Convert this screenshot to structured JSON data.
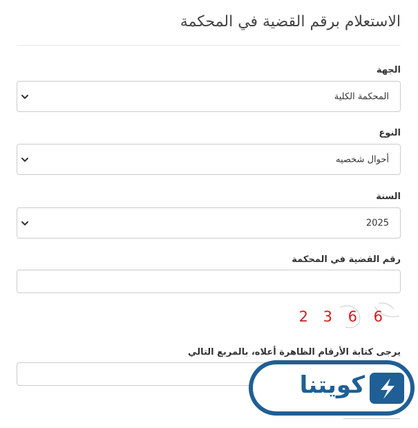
{
  "page": {
    "title": "الاستعلام برقم القضية في المحكمة"
  },
  "form": {
    "authority": {
      "label": "الجهة",
      "selected": "المحكمة الكلية"
    },
    "type": {
      "label": "النوع",
      "selected": "أحوال شخصيه"
    },
    "year": {
      "label": "السنة",
      "selected": "2025"
    },
    "case_number": {
      "label": "رقم القضية في المحكمة",
      "value": ""
    },
    "captcha": {
      "digits": [
        "2",
        "3",
        "6",
        "6"
      ],
      "label": "يرجى كتابة الأرقام الظاهرة أعلاه، بالمربع التالي",
      "value": ""
    }
  },
  "watermark": {
    "brand": "كويتنا",
    "color": "#1f5f95"
  },
  "icons": {
    "dropdown": "chevron-down-icon"
  },
  "colors": {
    "captcha_digits": "#cc1f1f",
    "border": "#cccccc"
  }
}
